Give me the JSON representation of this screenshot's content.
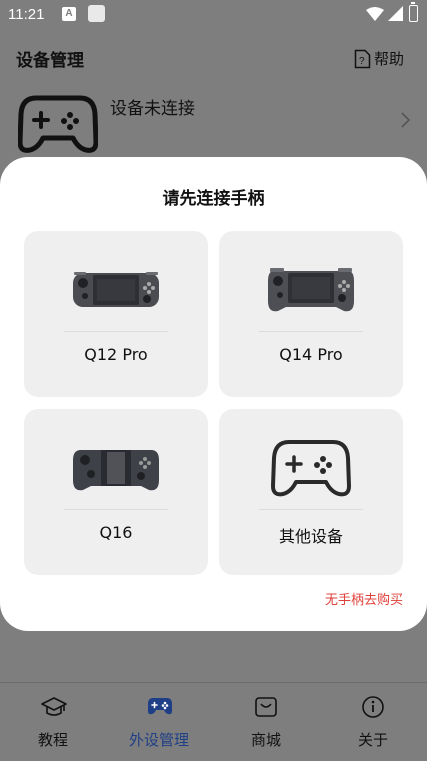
{
  "status_bar": {
    "time": "11:21",
    "notification_letter": "A"
  },
  "header": {
    "title": "设备管理",
    "help_label": "帮助"
  },
  "device": {
    "status_text": "设备未连接"
  },
  "modal": {
    "title": "请先连接手柄",
    "cards": [
      {
        "label": "Q12 Pro",
        "icon": "q12-pro-controller-image"
      },
      {
        "label": "Q14 Pro",
        "icon": "q14-pro-controller-image"
      },
      {
        "label": "Q16",
        "icon": "q16-controller-image"
      },
      {
        "label": "其他设备",
        "icon": "gamepad-outline-icon"
      }
    ],
    "buy_link": "无手柄去购买"
  },
  "bottom_nav": {
    "items": [
      {
        "label": "教程",
        "icon": "graduation-cap-icon"
      },
      {
        "label": "外设管理",
        "icon": "gamepad-icon",
        "active": true
      },
      {
        "label": "商城",
        "icon": "shopping-bag-icon"
      },
      {
        "label": "关于",
        "icon": "info-icon"
      }
    ]
  },
  "colors": {
    "overlay": "#7e7e7e",
    "accent": "#1e3f86",
    "buy_link": "#e0403a",
    "card_bg": "#efefef"
  }
}
